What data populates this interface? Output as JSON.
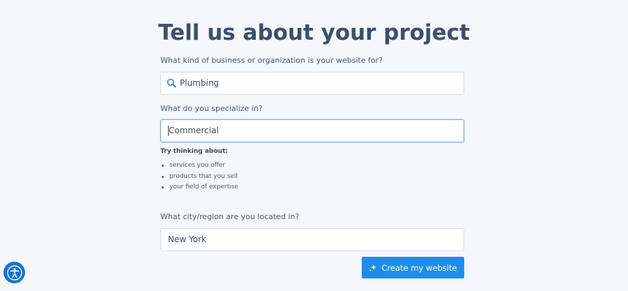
{
  "page": {
    "title": "Tell us about your project"
  },
  "form": {
    "business": {
      "label": "What kind of business or organization is your website for?",
      "value": "Plumbing"
    },
    "specialty": {
      "label": "What do you specialize in?",
      "value": "Commercial"
    },
    "hints": {
      "title": "Try thinking about:",
      "items": [
        "services you offer",
        "products that you sell",
        "your field of expertise"
      ]
    },
    "location": {
      "label": "What city/region are you located in?",
      "value": "New York"
    },
    "submit_label": "Create my website"
  },
  "icons": {
    "search": "search-icon",
    "sparkle": "sparkle-icon",
    "accessibility": "accessibility-icon"
  },
  "colors": {
    "background": "#f4f7fb",
    "title": "#3d4e6d",
    "accent": "#1f8de8",
    "focus_border": "#7aaee6",
    "accessibility": "#1673d6"
  }
}
